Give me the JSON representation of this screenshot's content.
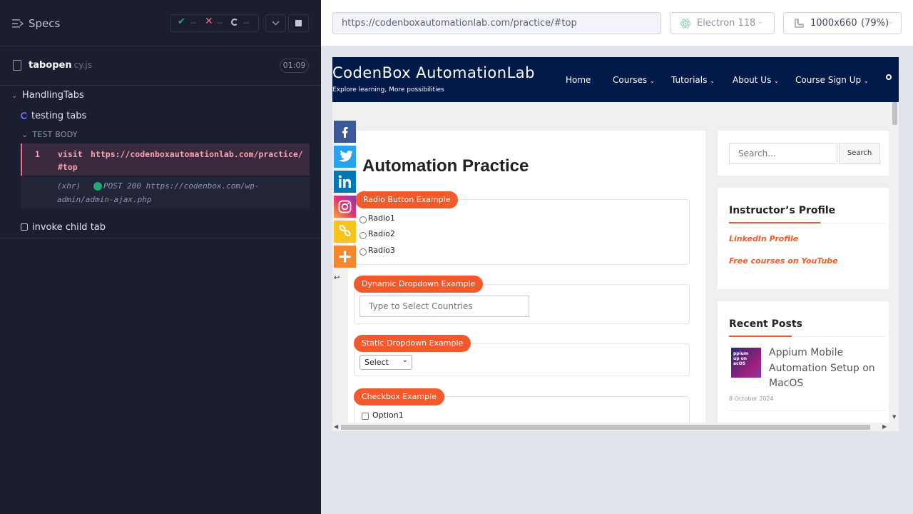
{
  "runner": {
    "specs_label": "Specs",
    "stats": {
      "passed": "--",
      "failed": "--",
      "pending": "--"
    },
    "file": {
      "name": "tabopen",
      "ext": "cy.js",
      "duration": "01:09"
    },
    "suite": {
      "title": "HandlingTabs"
    },
    "tests": [
      {
        "title": "testing tabs",
        "state": "running"
      },
      {
        "title": "invoke child tab",
        "state": "pending"
      }
    ],
    "test_body_label": "TEST BODY",
    "commands": [
      {
        "number": "1",
        "name": "visit",
        "url_line1": "https://codenboxautomationlab.com/practice/",
        "url_line2": "#top"
      },
      {
        "type": "(xhr)",
        "method_status": "POST 200 https://codenbox.com/wp-",
        "url_line2": "admin/admin-ajax.php"
      }
    ],
    "colors": {
      "bg": "#1b1e2e",
      "pass": "#1fa971",
      "fail": "#f36b8f",
      "accent": "#6470f3"
    }
  },
  "browser": {
    "url": "https://codenboxautomationlab.com/practice/#top",
    "browser_name": "Electron 118",
    "viewport": "1000x660",
    "scale": "(79%)"
  },
  "site": {
    "title": "CodenBox AutomationLab",
    "tagline": "Explore learning, More possibilities",
    "nav": [
      "Home",
      "Courses",
      "Tutorials",
      "About Us",
      "Course Sign Up"
    ],
    "page_heading": "Automation Practice",
    "radio_legend": "Radio Button Example",
    "radios": [
      "Radio1",
      "Radio2",
      "Radio3"
    ],
    "dynamic_legend": "Dynamic Dropdown Example",
    "dynamic_placeholder": "Type to Select Countries",
    "static_legend": "Static Dropdown Example",
    "static_selected": "Select",
    "checkbox_legend": "Checkbox Example",
    "checkboxes": [
      "Option1"
    ],
    "search_placeholder": "Search...",
    "search_button": "Search",
    "instructor_title": "Instructor’s Profile",
    "instructor_links": [
      "LinkedIn Profile",
      "Free courses on YouTube"
    ],
    "recent_title": "Recent Posts",
    "recent_post": {
      "title": "Appium Mobile Automation Setup on MacOS",
      "date": "8 October 2024",
      "thumb_text": "ppium\nup on\nacOS"
    },
    "social_icons": [
      "facebook-icon",
      "twitter-icon",
      "linkedin-icon",
      "instagram-icon",
      "copy-link-icon",
      "more-icon"
    ],
    "colors": {
      "header": "#021a49",
      "accent": "#f25a2c"
    }
  }
}
